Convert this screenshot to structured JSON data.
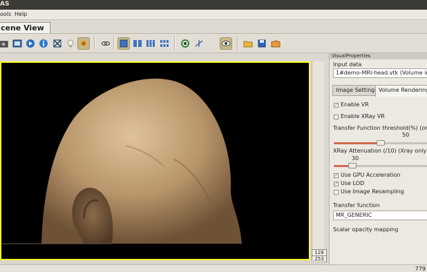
{
  "window": {
    "title_fragment": "AS"
  },
  "menu": {
    "items": [
      "ools",
      "Help"
    ]
  },
  "scene_tab": {
    "label": "cene View"
  },
  "toolbar": {
    "groups": [
      [
        "camera-icon",
        "record-icon",
        "play-icon",
        "globe-icon",
        "info-icon",
        "crossed-tools-icon",
        "bulb-icon",
        "plugin-icon"
      ],
      [
        "link-icon"
      ],
      [
        "layout-single-icon",
        "layout-two-icon",
        "layout-three-icon",
        "layout-grid-icon"
      ],
      [
        "refresh-icon",
        "axes-icon",
        "eye-icon"
      ],
      [
        "folder-open-icon",
        "save-icon",
        "export-icon"
      ]
    ]
  },
  "viewport": {
    "coord_top": "128",
    "coord_bottom": "253"
  },
  "status": {
    "right_text": "779"
  },
  "panel": {
    "title": "VisualProperties",
    "input_label": "Input data",
    "input_value": "1#demo-MRI-head.vtk (Volume imag",
    "tabs": [
      "Image Settings",
      "Volume Rendering"
    ],
    "active_tab": "Volume Rendering",
    "enable_vr": {
      "label": "Enable VR",
      "checked": true
    },
    "enable_xray": {
      "label": "Enable XRay VR",
      "checked": false
    },
    "tf_threshold": {
      "label": "Transfer Function threshold(%) (only fo",
      "value": "50",
      "fraction": 0.5
    },
    "xray_att": {
      "label": "XRay Attenuation (/10) (Xray only)",
      "value": "30",
      "fraction": 0.2
    },
    "use_gpu": {
      "label": "Use GPU Acceleration",
      "checked": true
    },
    "use_lod": {
      "label": "Use LOD",
      "checked": true
    },
    "use_resampling": {
      "label": "Use Image Resampling",
      "checked": false
    },
    "tf_label": "Transfer function",
    "tf_value": "MR_GENERIC",
    "opacity_label": "Scalar opacity mapping"
  },
  "colors": {
    "viewport_border": "#ffff22",
    "accent": "#d06a4e",
    "check": "#c0302a"
  }
}
